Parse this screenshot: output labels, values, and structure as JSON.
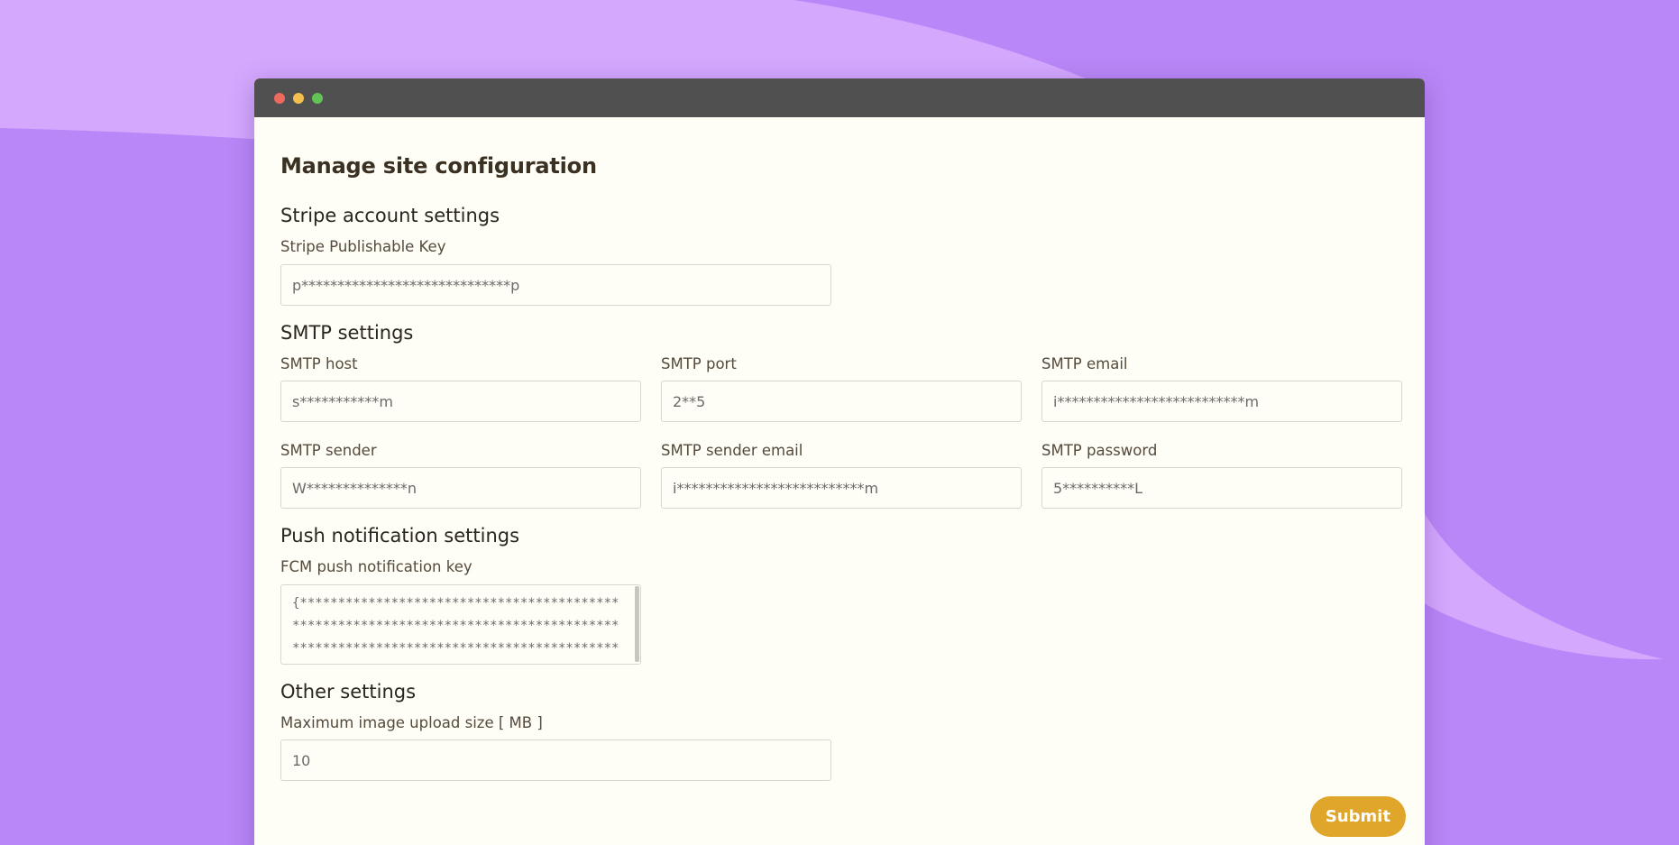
{
  "colors": {
    "background": "#d3a8fd",
    "background_wave": "#b987f7",
    "titlebar": "#505050",
    "panel": "#fefdf6",
    "accent": "#e0a62c"
  },
  "window": {
    "controls": [
      "close-dot",
      "minimize-dot",
      "maximize-dot"
    ]
  },
  "page": {
    "title": "Manage site configuration"
  },
  "stripe": {
    "section_title": "Stripe account settings",
    "publishable_key_label": "Stripe Publishable Key",
    "publishable_key_value": "p*****************************p"
  },
  "smtp": {
    "section_title": "SMTP settings",
    "host_label": "SMTP host",
    "host_value": "s***********m",
    "port_label": "SMTP port",
    "port_value": "2**5",
    "email_label": "SMTP email",
    "email_value": "i**************************m",
    "sender_label": "SMTP sender",
    "sender_value": "W**************n",
    "sender_email_label": "SMTP sender email",
    "sender_email_value": "i**************************m",
    "password_label": "SMTP password",
    "password_value": "5**********L"
  },
  "push": {
    "section_title": "Push notification settings",
    "fcm_key_label": "FCM push notification key",
    "fcm_key_value": "{**********************************************************************************************************************************************************************************************************"
  },
  "other": {
    "section_title": "Other settings",
    "max_upload_label": "Maximum image upload size [ MB ]",
    "max_upload_value": "10"
  },
  "actions": {
    "submit_label": "Submit"
  }
}
